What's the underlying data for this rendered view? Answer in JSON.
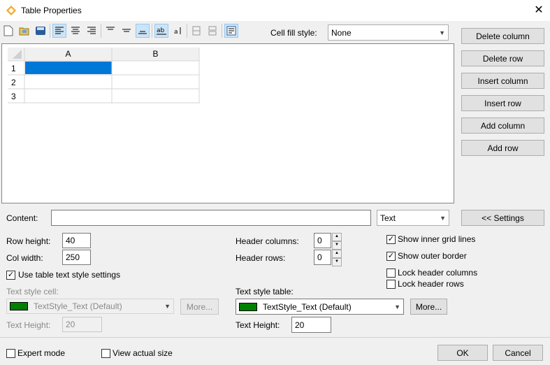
{
  "window": {
    "title": "Table Properties",
    "close_symbol": "✕"
  },
  "toolbar": {
    "buttons": [
      "new-icon",
      "open-icon",
      "save-icon",
      "align-left-icon",
      "align-center-icon",
      "align-right-icon",
      "valign-top-icon",
      "valign-middle-icon",
      "valign-bottom-icon",
      "wrap-text-icon",
      "vertical-text-icon",
      "merge-cells-icon",
      "split-cells-icon",
      "cell-properties-icon"
    ],
    "cell_fill_label": "Cell fill style:",
    "cell_fill_value": "None"
  },
  "grid": {
    "columns": [
      "A",
      "B"
    ],
    "rows": [
      "1",
      "2",
      "3"
    ],
    "selected_cell": "A1",
    "selection_color": "#0078d7"
  },
  "side_buttons": {
    "delete_column": "Delete column",
    "delete_row": "Delete row",
    "insert_column": "Insert column",
    "insert_row": "Insert row",
    "add_column": "Add column",
    "add_row": "Add row"
  },
  "content": {
    "label": "Content:",
    "value": "",
    "type_value": "Text",
    "settings_button": "<< Settings"
  },
  "settings": {
    "row_height_label": "Row height:",
    "row_height_value": "40",
    "col_width_label": "Col width:",
    "col_width_value": "250",
    "use_table_style_label": "Use table text style settings",
    "use_table_style_checked": true,
    "header_columns_label": "Header columns:",
    "header_columns_value": "0",
    "header_rows_label": "Header rows:",
    "header_rows_value": "0",
    "show_inner_grid_label": "Show inner grid lines",
    "show_inner_grid_checked": true,
    "show_outer_border_label": "Show outer border",
    "show_outer_border_checked": true,
    "lock_header_columns_label": "Lock header columns",
    "lock_header_columns_checked": false,
    "lock_header_rows_label": "Lock header rows",
    "lock_header_rows_checked": false,
    "text_style_cell_label": "Text style cell:",
    "text_style_cell_value": "TextStyle_Text (Default)",
    "text_style_table_label": "Text style table:",
    "text_style_table_value": "TextStyle_Text (Default)",
    "more_button": "More...",
    "text_height_label": "Text Height:",
    "text_height_cell_value": "20",
    "text_height_table_value": "20",
    "style_swatch_color": "#008000"
  },
  "footer": {
    "expert_mode_label": "Expert mode",
    "expert_mode_checked": false,
    "view_actual_size_label": "View actual size",
    "view_actual_size_checked": false,
    "ok_button": "OK",
    "cancel_button": "Cancel"
  }
}
